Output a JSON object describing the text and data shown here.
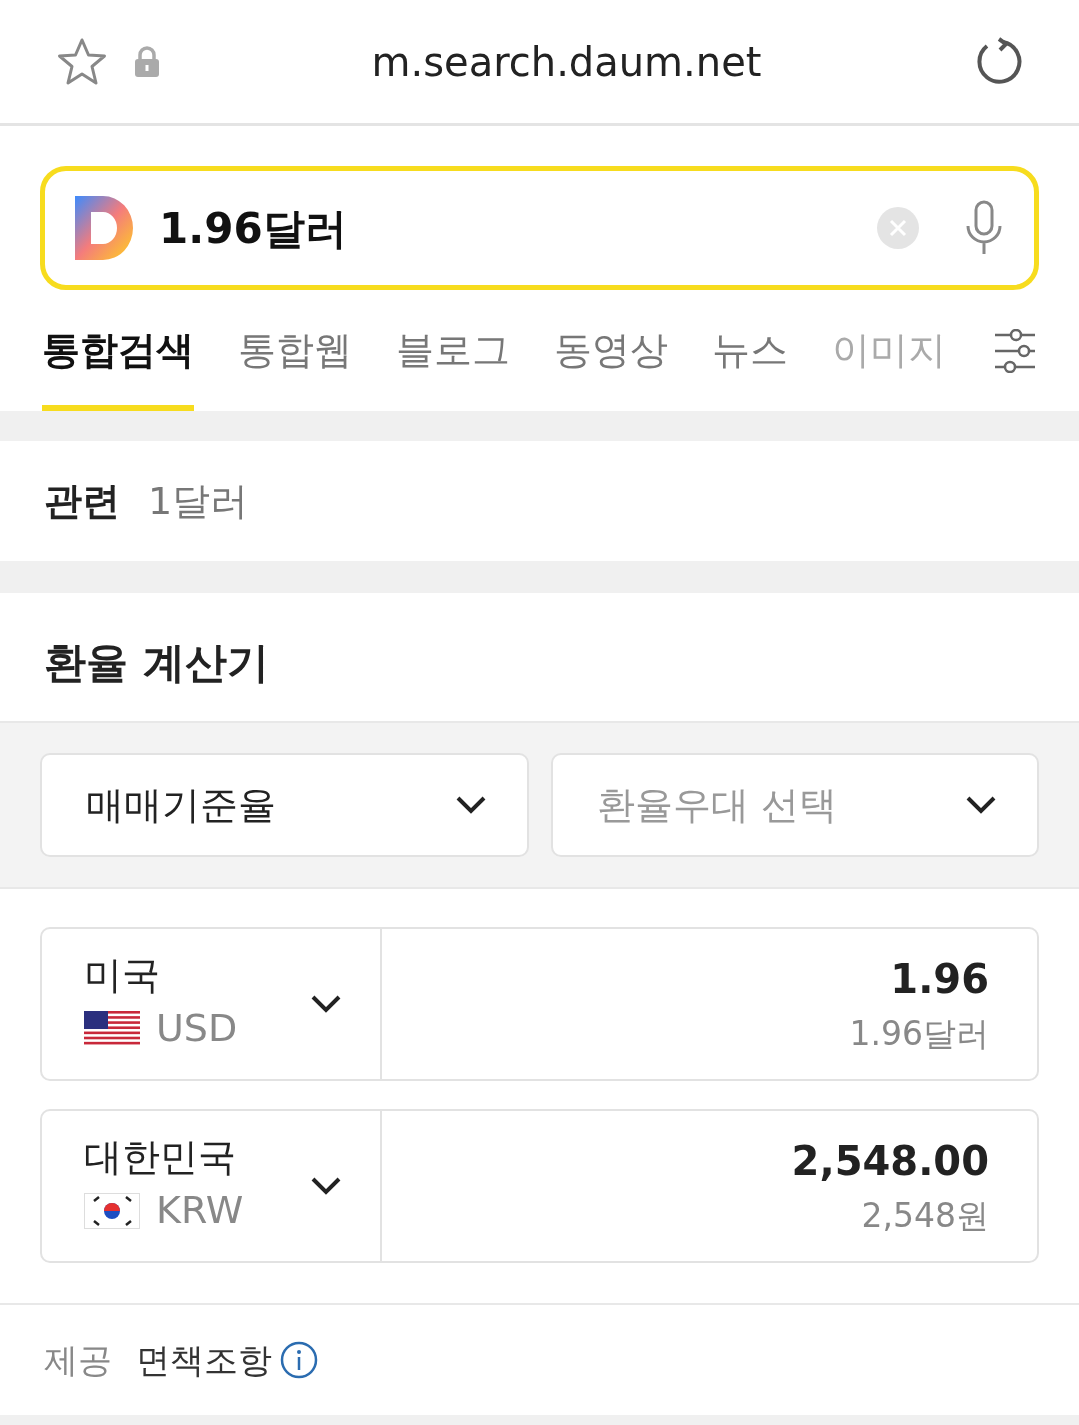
{
  "browser_bar": {
    "url": "m.search.daum.net",
    "bookmarked": false,
    "secure": true
  },
  "search": {
    "query": "1.96달러"
  },
  "tabs": [
    {
      "label": "통합검색",
      "selected": true
    },
    {
      "label": "통합웹",
      "selected": false
    },
    {
      "label": "블로그",
      "selected": false
    },
    {
      "label": "동영상",
      "selected": false
    },
    {
      "label": "뉴스",
      "selected": false
    },
    {
      "label": "이미지",
      "selected": false
    }
  ],
  "related": {
    "label": "관련",
    "items": [
      "1달러"
    ]
  },
  "calculator": {
    "title": "환율 계산기",
    "selects": [
      {
        "value": "매매기준율"
      },
      {
        "placeholder": "환율우대 선택"
      }
    ],
    "currencies": [
      {
        "country": "미국",
        "code": "USD",
        "kind": "us",
        "amount": "1.96",
        "amount_text": "1.96달러"
      },
      {
        "country": "대한민국",
        "code": "KRW",
        "kind": "kr",
        "amount": "2,548.00",
        "amount_text": "2,548원"
      }
    ],
    "footer": {
      "provider_label": "제공",
      "disclaimer": "면책조항"
    }
  }
}
